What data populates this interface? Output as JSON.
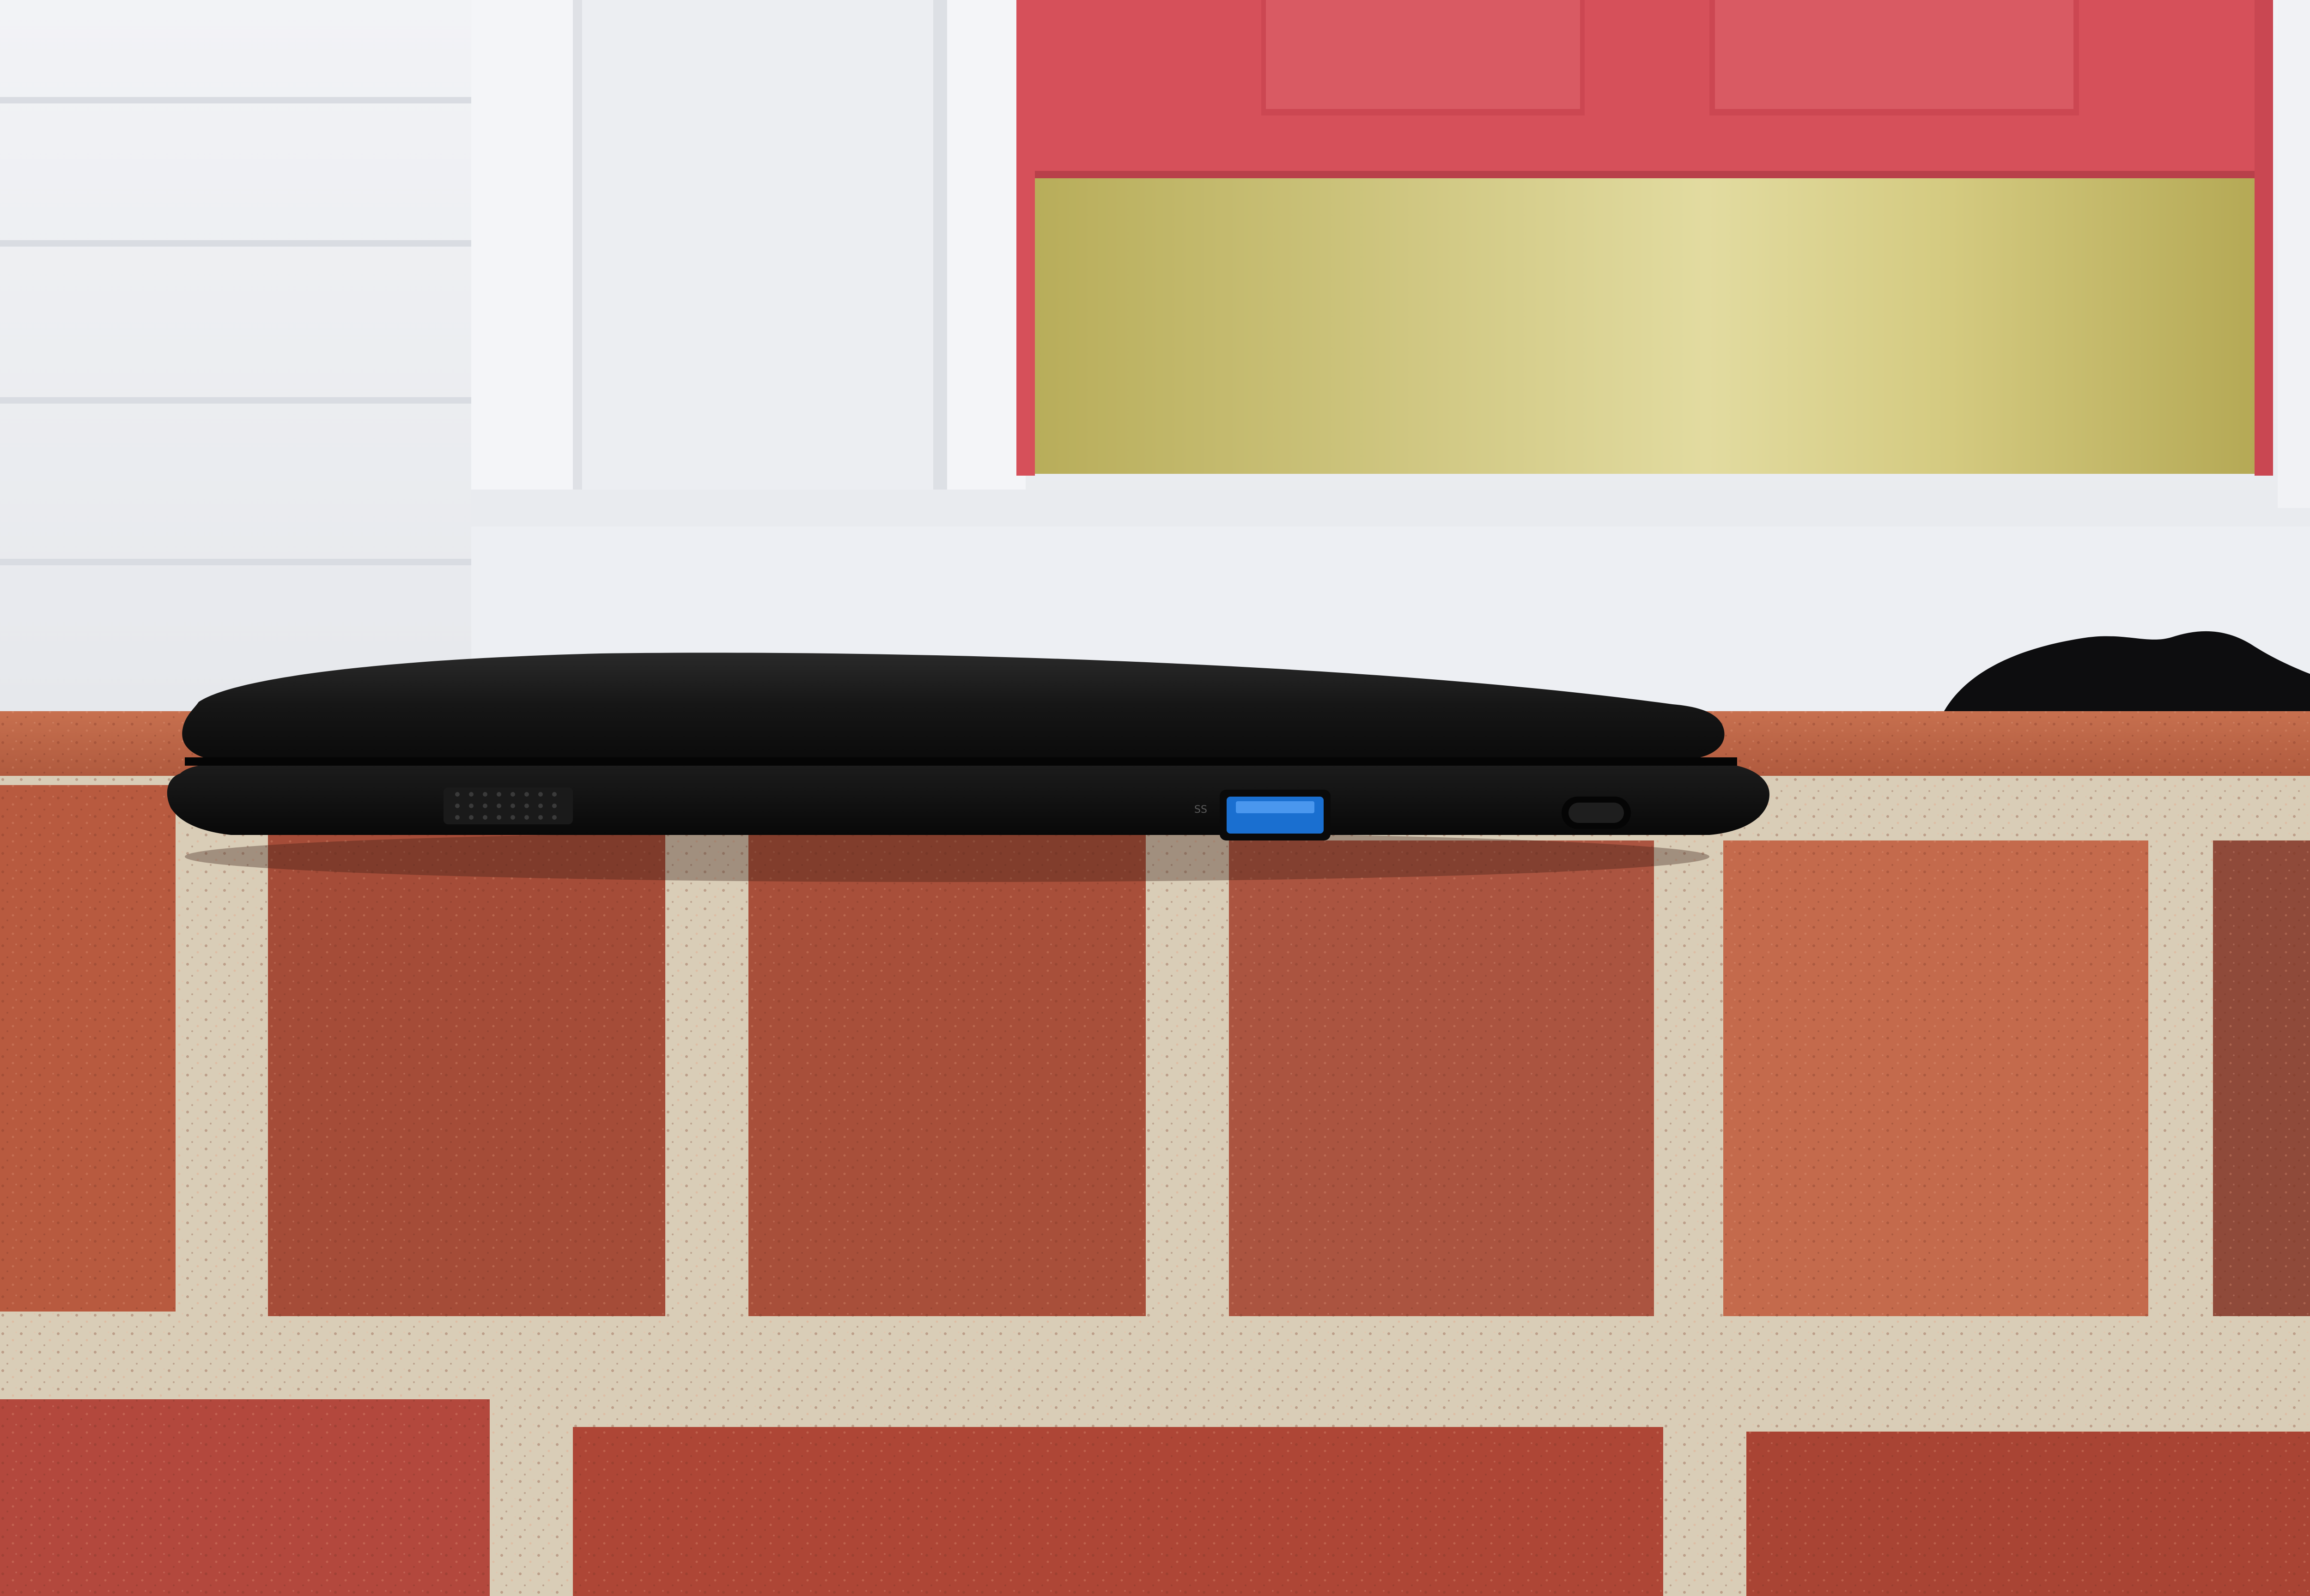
{
  "scene": {
    "description_tags": [
      "laptop-side-profile",
      "brick-ledge",
      "red-door",
      "white-siding"
    ]
  },
  "laptop": {
    "color": "#141414",
    "usb_port_color": "#1a6fd0",
    "port_label": "SS",
    "ports": [
      "usb-3.0-port",
      "kensington-lock-slot",
      "speaker-grille"
    ]
  },
  "door": {
    "color": "#d8505a",
    "kickplate_color": "#c8bd6e"
  },
  "wall": {
    "siding_color": "#eef0f3",
    "brick_colors": [
      "#b85a3f",
      "#a54c38",
      "#c46a4c",
      "#9a4a3a"
    ],
    "mortar_color": "#d9cdb7"
  }
}
